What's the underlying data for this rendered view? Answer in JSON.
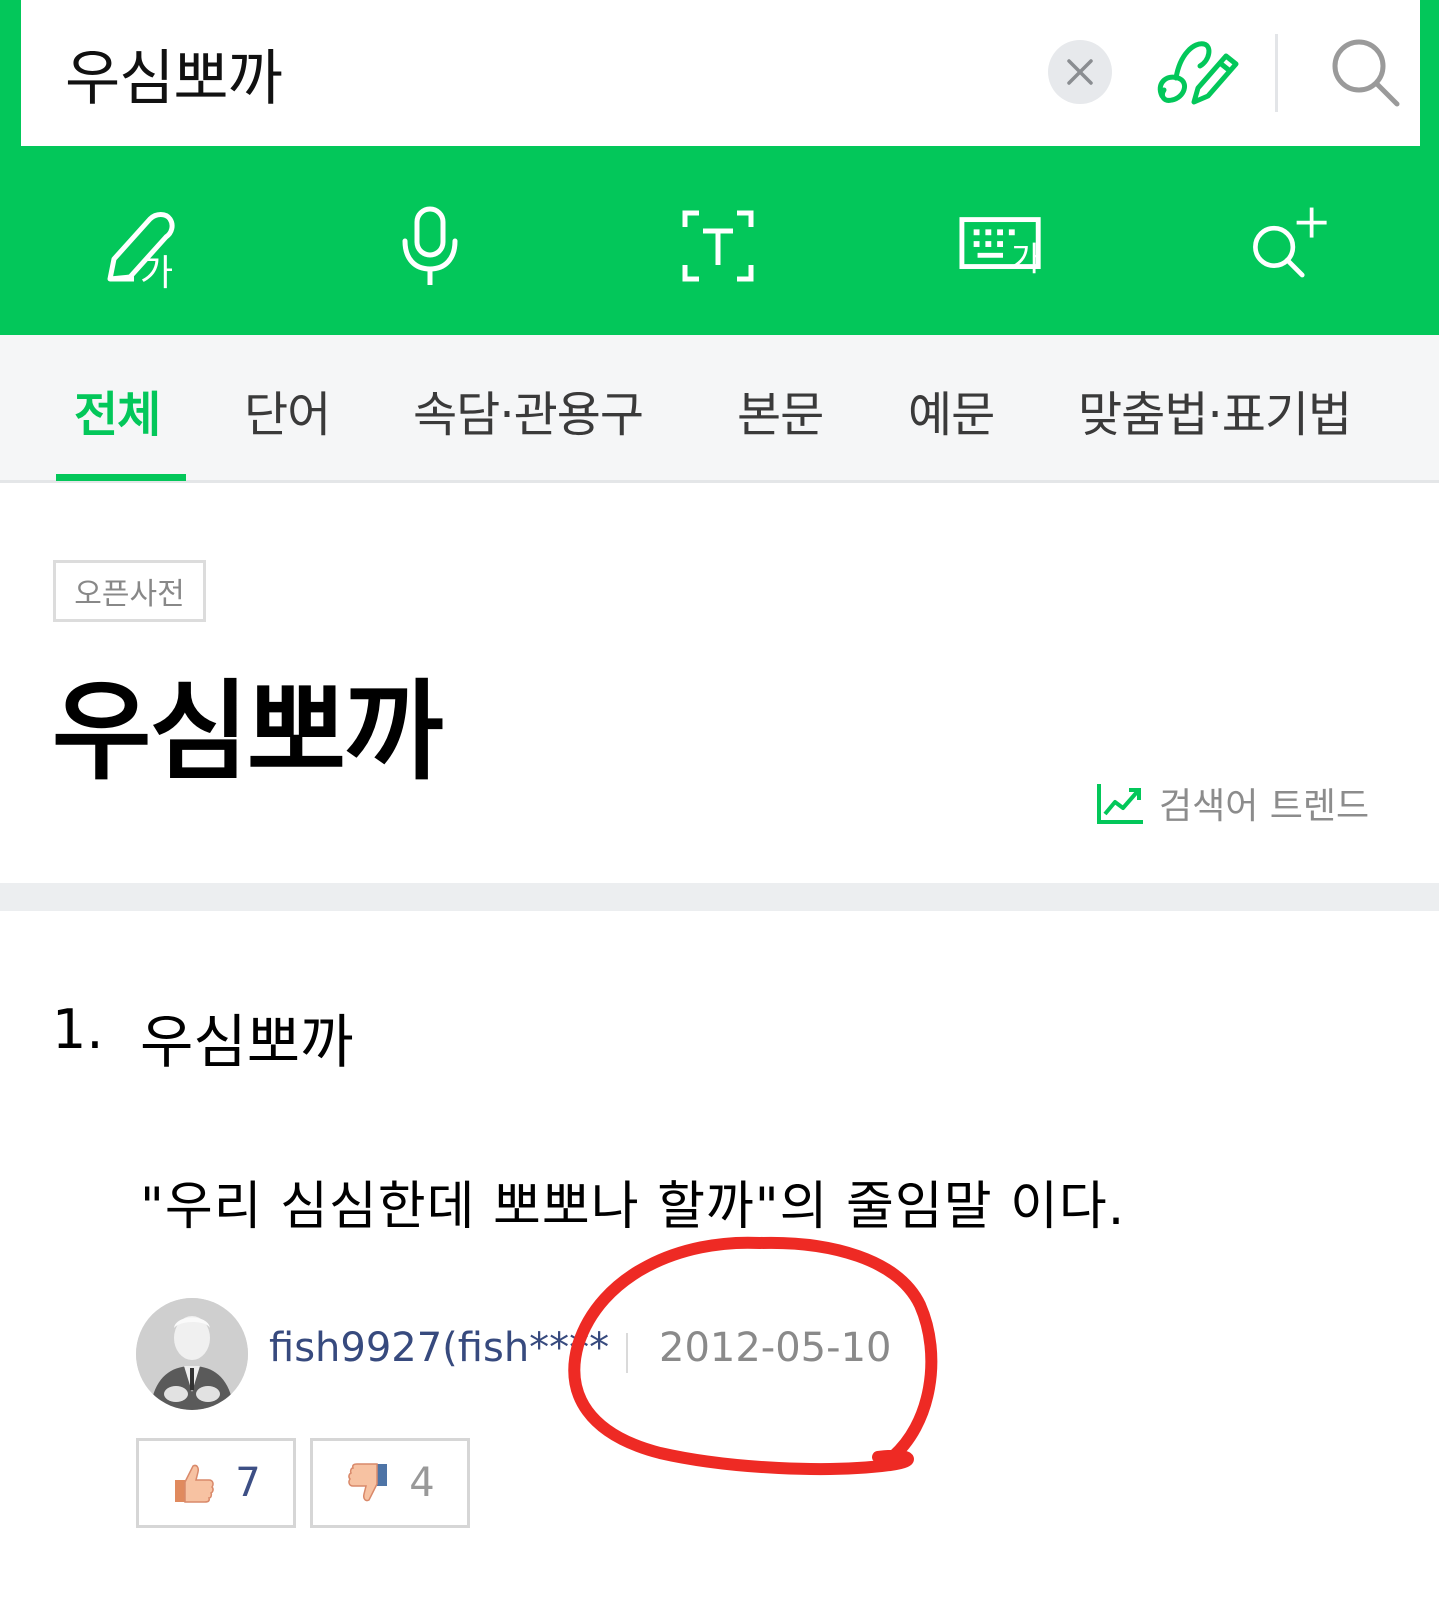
{
  "search": {
    "query": "우심뽀까"
  },
  "tabs": [
    {
      "label": "전체",
      "active": true
    },
    {
      "label": "단어"
    },
    {
      "label": "속담·관용구"
    },
    {
      "label": "본문"
    },
    {
      "label": "예문"
    },
    {
      "label": "맞춤법·표기법"
    }
  ],
  "entry_header": {
    "source_badge": "오픈사전",
    "title": "우심뽀까",
    "trend_label": "검색어 트렌드"
  },
  "entry": {
    "number": "1.",
    "word": "우심뽀까",
    "definition": "\"우리 심심한데 뽀뽀나 할까\"의 줄임말 이다.",
    "author": "fish9927(fish****",
    "date": "2012-05-10",
    "likes": "7",
    "dislikes": "4"
  },
  "colors": {
    "brand_green": "#03c75a",
    "annotation_red": "#ee2a24",
    "author_link": "#374a7e"
  },
  "icons": [
    "clear-icon",
    "handwriting-pen-icon",
    "search-icon",
    "handwriting-input-icon",
    "microphone-icon",
    "text-scan-icon",
    "keyboard-icon",
    "search-plus-icon",
    "trend-chart-icon",
    "thumbs-up-icon",
    "thumbs-down-icon"
  ]
}
